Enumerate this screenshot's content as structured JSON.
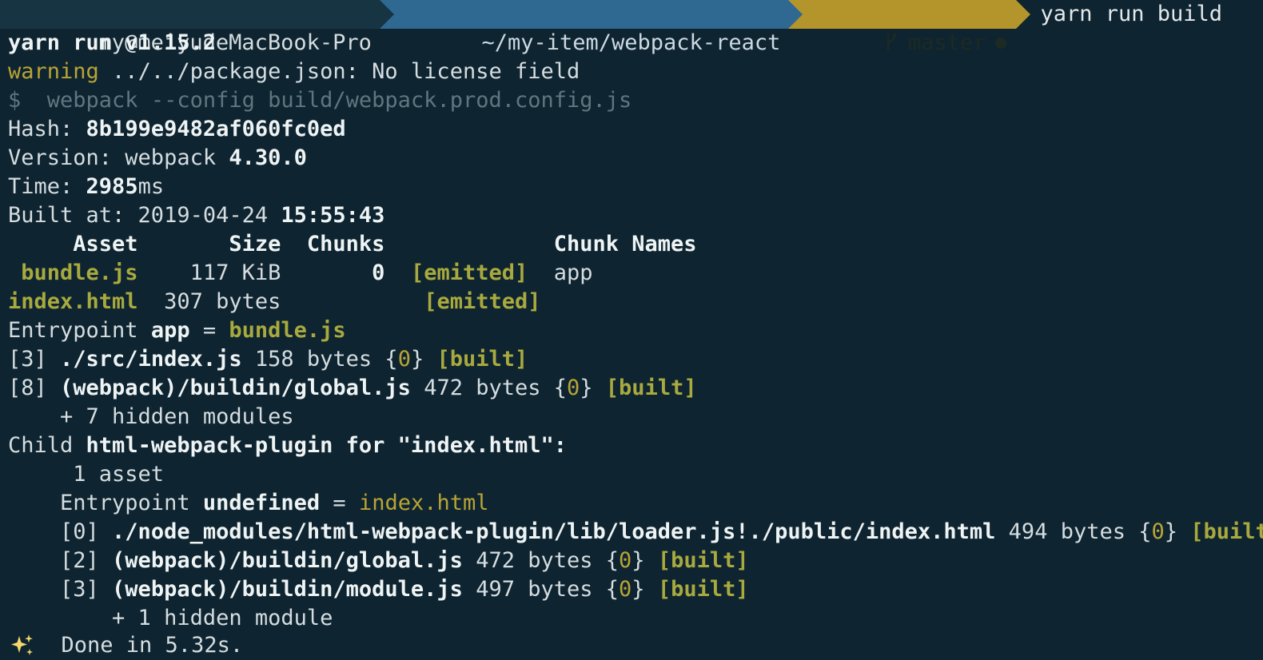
{
  "prompt": {
    "user_host": "my@meiyudeMacBook-Pro",
    "path": "~/my-item/webpack-react",
    "branch": "master",
    "command": "yarn run build"
  },
  "output": {
    "yarn_version": "yarn run v1.15.2",
    "warning_label": "warning",
    "warning_text": " ../../package.json: No license field",
    "dollar": "$",
    "run_cmd": "  webpack --config build/webpack.prod.config.js",
    "hash_label": "Hash: ",
    "hash_value": "8b199e9482af060fc0ed",
    "version_label": "Version: webpack ",
    "version_value": "4.30.0",
    "time_label": "Time: ",
    "time_value": "2985",
    "time_unit": "ms",
    "built_label": "Built at: 2019-04-24 ",
    "built_time": "15:55:43",
    "table_headers": {
      "asset": "     Asset",
      "size": "       Size",
      "chunks": "  Chunks",
      "chunk_names": "             Chunk Names"
    },
    "assets": [
      {
        "name": " bundle.js",
        "size": "    117 KiB",
        "chunks": "       0",
        "status": "[emitted]",
        "chunk_name": "app"
      },
      {
        "name": "index.html",
        "size": "  307 bytes",
        "chunks": "         ",
        "status": "[emitted]",
        "chunk_name": ""
      }
    ],
    "entrypoint_label": "Entrypoint ",
    "entrypoint_name": "app",
    "entrypoint_eq": " = ",
    "entrypoint_file": "bundle.js",
    "modules": [
      {
        "id": "[3] ",
        "path": "./src/index.js",
        "size": " 158 bytes {",
        "chunk": "0",
        "close": "} ",
        "status": "[built]"
      },
      {
        "id": "[8] ",
        "path": "(webpack)/buildin/global.js",
        "size": " 472 bytes {",
        "chunk": "0",
        "close": "} ",
        "status": "[built]"
      }
    ],
    "hidden_modules": "    + 7 hidden modules",
    "child_label": "Child ",
    "child_name": "html-webpack-plugin for \"index.html\"",
    "child_colon": ":",
    "child_assets": "     1 asset",
    "child_entry_label": "    Entrypoint ",
    "child_entry_name": "undefined",
    "child_entry_eq": " = ",
    "child_entry_file": "index.html",
    "child_modules": [
      {
        "id": "    [0] ",
        "path": "./node_modules/html-webpack-plugin/lib/loader.js!./public/index.html",
        "size": " 494 bytes {",
        "chunk": "0",
        "close": "} ",
        "status": "[built]"
      },
      {
        "id": "    [2] ",
        "path": "(webpack)/buildin/global.js",
        "size": " 472 bytes {",
        "chunk": "0",
        "close": "} ",
        "status": "[built]"
      },
      {
        "id": "    [3] ",
        "path": "(webpack)/buildin/module.js",
        "size": " 497 bytes {",
        "chunk": "0",
        "close": "} ",
        "status": "[built]"
      }
    ],
    "child_hidden": "        + 1 hidden module",
    "done_text": "  Done in 5.32s."
  },
  "icons": {
    "branch": "git-branch-icon",
    "dirty": "dirty-dot-icon",
    "sparkle": "sparkles-icon"
  }
}
